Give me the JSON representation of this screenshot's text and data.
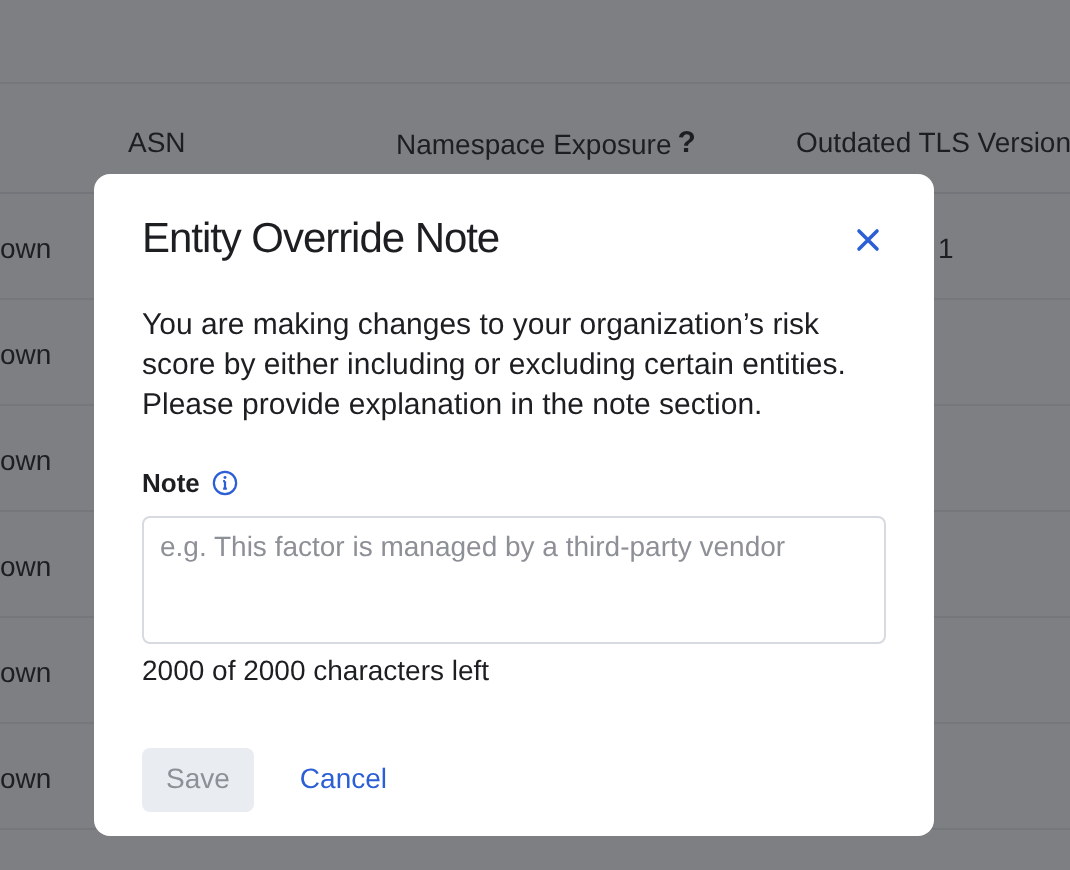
{
  "table": {
    "columns": [
      {
        "label": "ASN"
      },
      {
        "label": "Namespace Exposure",
        "help_mark": "?"
      },
      {
        "label": "Outdated TLS Version"
      }
    ],
    "rows": [
      {
        "column_1": "own",
        "column_4": "1"
      },
      {
        "column_1": "own"
      },
      {
        "column_1": "own"
      },
      {
        "column_1": "own"
      },
      {
        "column_1": "own"
      },
      {
        "column_1": "own"
      }
    ]
  },
  "dialog": {
    "title": "Entity Override Note",
    "description": "You are making changes to your organization’s risk score by either including or excluding certain entities. Please provide explanation in the note section.",
    "field": {
      "label": "Note",
      "placeholder": "e.g. This factor is managed by a third-party vendor",
      "counter": "2000 of 2000 characters left"
    },
    "buttons": [
      {
        "label": "Save",
        "kind": "primary",
        "disabled": true
      },
      {
        "label": "Cancel",
        "kind": "link",
        "disabled": false
      }
    ]
  }
}
